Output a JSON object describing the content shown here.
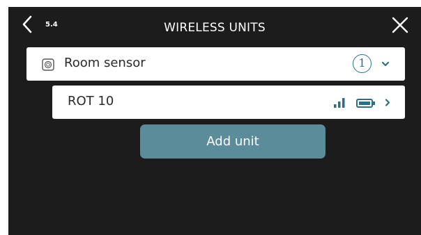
{
  "header": {
    "menu_number": "5.4",
    "title": "WIRELESS UNITS"
  },
  "unit_groups": [
    {
      "label": "Room sensor",
      "count": "1",
      "icon": "room-sensor-icon",
      "units": [
        {
          "name": "ROT 10",
          "signal_icon": "signal-strength-icon",
          "battery_icon": "battery-icon"
        }
      ]
    }
  ],
  "actions": {
    "add_unit_label": "Add unit"
  },
  "colors": {
    "screen_background": "#1c1c1c",
    "accent": "#2b6f87",
    "button": "#5b8c9a"
  }
}
